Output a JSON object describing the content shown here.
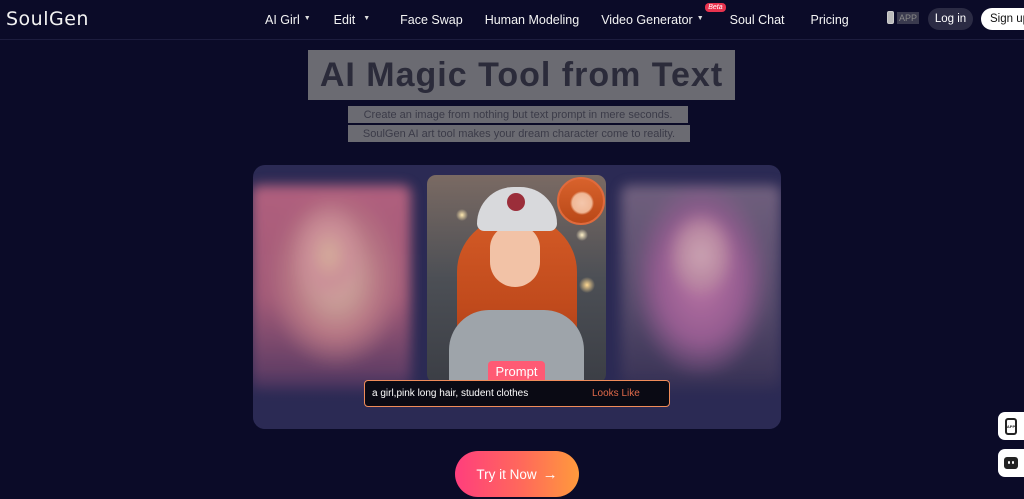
{
  "nav": {
    "logo": "SoulGen",
    "items": [
      {
        "label": "AI Girl",
        "dropdown": true
      },
      {
        "label": "Edit",
        "dropdown": true
      },
      {
        "label": "Face Swap",
        "dropdown": false
      },
      {
        "label": "Human Modeling",
        "dropdown": false
      },
      {
        "label": "Video Generator",
        "dropdown": true,
        "badge": "Beta"
      },
      {
        "label": "Soul Chat",
        "dropdown": false
      },
      {
        "label": "Pricing",
        "dropdown": false
      }
    ],
    "app_label": "APP",
    "login_label": "Log in",
    "signup_label": "Sign up"
  },
  "hero": {
    "title": "AI Magic Tool from Text",
    "subtitle_line1": "Create an image from nothing but text prompt in mere seconds.",
    "subtitle_line2": "SoulGen AI art tool makes your dream character come to reality."
  },
  "showcase": {
    "prompt_tag": "Prompt",
    "prompt_text": "a girl,pink long hair, student clothes",
    "looks_like": "Looks Like"
  },
  "cta": {
    "label": "Try it Now",
    "arrow": "→"
  },
  "floating": {
    "app_label": "APP"
  },
  "colors": {
    "background": "#0b0b28",
    "panel": "#2b2a54",
    "accent_pink": "#ff5a74",
    "accent_orange": "#ff9a3c"
  }
}
